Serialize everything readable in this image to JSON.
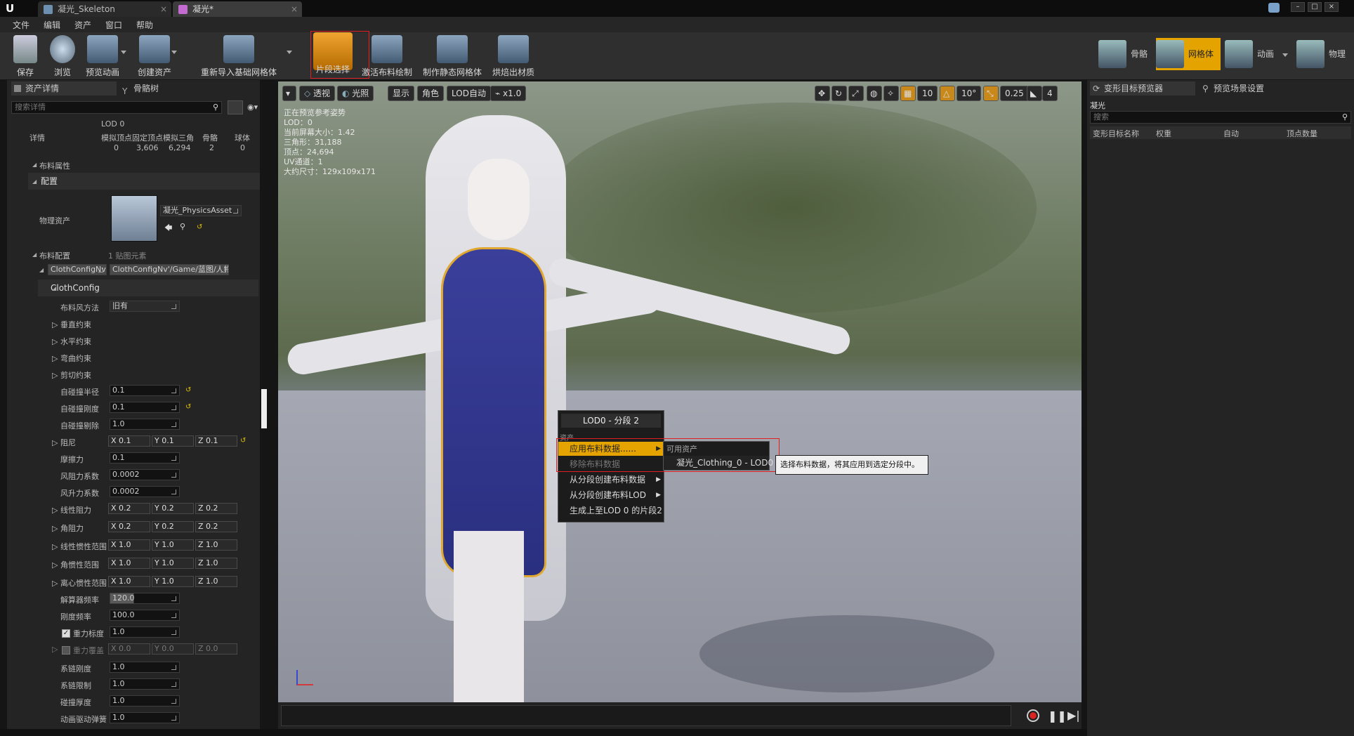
{
  "window": {
    "tabs": [
      {
        "label": "凝光_Skeleton"
      },
      {
        "label": "凝光*"
      }
    ]
  },
  "menubar": [
    "文件",
    "编辑",
    "资产",
    "窗口",
    "帮助"
  ],
  "toolbar": {
    "buttons": [
      "保存",
      "浏览",
      "预览动画",
      "创建资产",
      "重新导入基础网格体",
      "片段选择",
      "激活布料绘制",
      "制作静态网格体",
      "烘焙出材质"
    ],
    "modes": [
      "骨骼",
      "网格体",
      "动画",
      "物理"
    ]
  },
  "left": {
    "tabs": [
      "资产详情",
      "骨骼树"
    ],
    "search_placeholder": "搜索详情",
    "lod": {
      "title": "LOD 0",
      "row_label": "详情",
      "headers": [
        "模拟顶点",
        "固定顶点",
        "模拟三角",
        "骨骼",
        "球体"
      ],
      "values": [
        "0",
        "3,606",
        "6,294",
        "2",
        "0"
      ]
    },
    "cloth_props": "布料属性",
    "config": "配置",
    "physics_label": "物理资产",
    "physics_asset": "凝光_PhysicsAsset",
    "cloth_config": "布料配置",
    "cloth_count": "1 贴图元素",
    "config_name": "ClothConfigNv",
    "config_path": "ClothConfigNv'/Game/蓝图/人物/",
    "clothconfig": "ClothConfig",
    "wind_method_label": "布料风方法",
    "wind_method": "旧有",
    "constraints": [
      "垂直约束",
      "水平约束",
      "弯曲约束",
      "剪切约束"
    ],
    "scalars": [
      {
        "label": "自碰撞半径",
        "value": "0.1"
      },
      {
        "label": "自碰撞刚度",
        "value": "0.1"
      },
      {
        "label": "自碰撞剔除",
        "value": "1.0"
      }
    ],
    "damping": {
      "label": "阻尼",
      "x": "X 0.1",
      "y": "Y 0.1",
      "z": "Z 0.1"
    },
    "scalars2": [
      {
        "label": "摩擦力",
        "value": "0.1"
      },
      {
        "label": "风阻力系数",
        "value": "0.0002"
      },
      {
        "label": "风升力系数",
        "value": "0.0002"
      }
    ],
    "vectors": [
      {
        "label": "线性阻力",
        "x": "X 0.2",
        "y": "Y 0.2",
        "z": "Z 0.2"
      },
      {
        "label": "角阻力",
        "x": "X 0.2",
        "y": "Y 0.2",
        "z": "Z 0.2"
      },
      {
        "label": "线性惯性范围",
        "x": "X 1.0",
        "y": "Y 1.0",
        "z": "Z 1.0"
      },
      {
        "label": "角惯性范围",
        "x": "X 1.0",
        "y": "Y 1.0",
        "z": "Z 1.0"
      },
      {
        "label": "离心惯性范围",
        "x": "X 1.0",
        "y": "Y 1.0",
        "z": "Z 1.0"
      }
    ],
    "solver_label": "解算器频率",
    "solver": "120.0",
    "stiff_label": "刚度频率",
    "stiff": "100.0",
    "gravity_scale_label": "重力标度",
    "gravity_scale": "1.0",
    "gravity_override": {
      "label": "重力覆盖",
      "x": "X 0.0",
      "y": "Y 0.0",
      "z": "Z 0.0"
    },
    "tail": [
      {
        "label": "系链刚度",
        "value": "1.0"
      },
      {
        "label": "系链限制",
        "value": "1.0"
      },
      {
        "label": "碰撞厚度",
        "value": "1.0"
      },
      {
        "label": "动画驱动弹簧",
        "value": "1.0"
      }
    ]
  },
  "viewport": {
    "buttons": [
      "透视",
      "光照",
      "显示",
      "角色",
      "LOD自动",
      "x1.0"
    ],
    "right_values": [
      "10",
      "10°",
      "0.25",
      "4"
    ],
    "info": [
      "正在预览参考姿势",
      "LOD：0",
      "当前屏幕大小：1.42",
      "三角形：31,188",
      "顶点：24,694",
      "UV通道：1",
      "大约尺寸：129x109x171"
    ]
  },
  "context_menu": {
    "title": "LOD0 - 分段 2",
    "section": "资产",
    "items": [
      "应用布料数据......",
      "移除布料数据",
      "从分段创建布料数据",
      "从分段创建布料LOD",
      "生成上至LOD 0 的片段2"
    ],
    "submenu_header": "可用资产",
    "submenu_item": "凝光_Clothing_0 - LOD0",
    "tooltip": "选择布料数据，将其应用到选定分段中。"
  },
  "right": {
    "tabs": [
      "变形目标预览器",
      "预览场景设置"
    ],
    "asset": "凝光",
    "search_placeholder": "搜索",
    "headers": [
      "变形目标名称",
      "权重",
      "自动",
      "顶点数量"
    ]
  },
  "colors": {
    "accent": "#e5a300",
    "highlight_red": "#e02020"
  }
}
